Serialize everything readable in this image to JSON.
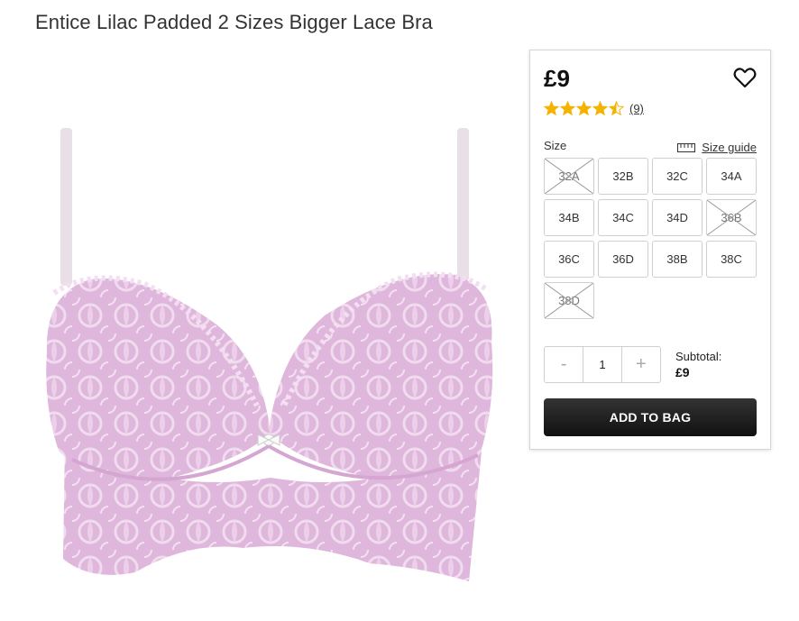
{
  "product": {
    "title": "Entice Lilac Padded 2 Sizes Bigger Lace Bra",
    "image_icon": "lilac-lace-bra-image"
  },
  "panel": {
    "price": "£9",
    "wishlist_icon": "heart-outline-icon",
    "rating": {
      "stars": 4.5,
      "max": 5,
      "review_count": "(9)"
    },
    "size_label": "Size",
    "size_guide_label": "Size guide",
    "size_guide_icon": "ruler-icon",
    "sizes": [
      {
        "label": "32A",
        "available": false
      },
      {
        "label": "32B",
        "available": true
      },
      {
        "label": "32C",
        "available": true
      },
      {
        "label": "34A",
        "available": true
      },
      {
        "label": "34B",
        "available": true
      },
      {
        "label": "34C",
        "available": true
      },
      {
        "label": "34D",
        "available": true
      },
      {
        "label": "36B",
        "available": false
      },
      {
        "label": "36C",
        "available": true
      },
      {
        "label": "36D",
        "available": true
      },
      {
        "label": "38B",
        "available": true
      },
      {
        "label": "38C",
        "available": true
      },
      {
        "label": "38D",
        "available": false
      }
    ],
    "quantity": {
      "minus": "-",
      "value": "1",
      "plus": "+"
    },
    "subtotal_label": "Subtotal:",
    "subtotal_value": "£9",
    "add_to_bag_label": "ADD TO BAG"
  },
  "colors": {
    "star": "#f5b301",
    "button_bg": "#1a1a1a",
    "bra_lilac": "#e6c3e3"
  }
}
